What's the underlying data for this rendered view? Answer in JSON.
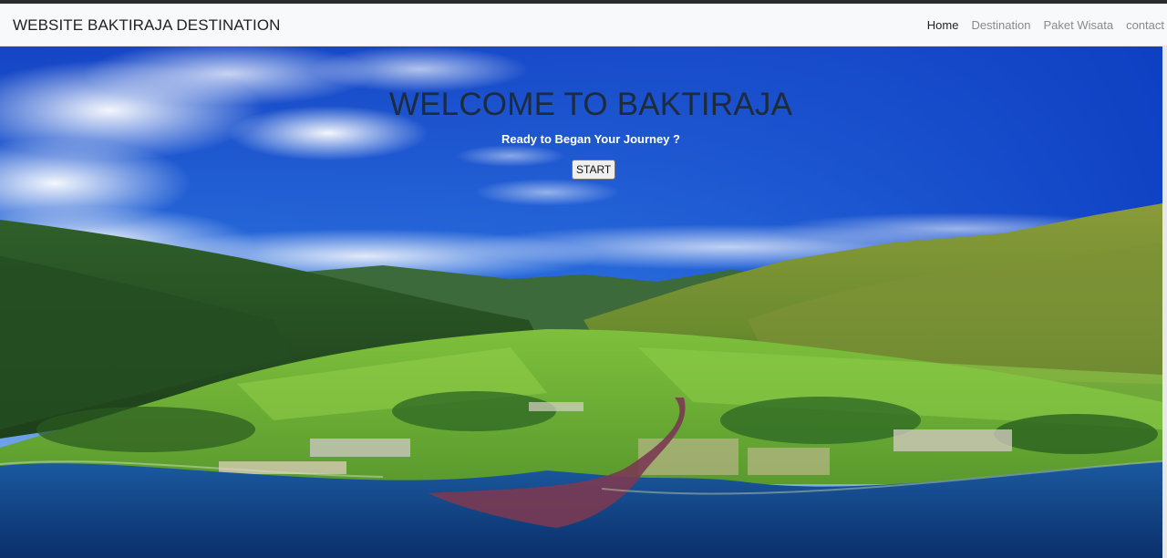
{
  "navbar": {
    "brand": "WEBSITE BAKTIRAJA DESTINATION",
    "links": [
      {
        "label": "Home",
        "active": true
      },
      {
        "label": "Destination",
        "active": false
      },
      {
        "label": "Paket Wisata",
        "active": false
      },
      {
        "label": "contact",
        "active": false
      }
    ]
  },
  "hero": {
    "title": "WELCOME TO BAKTIRAJA",
    "subtitle": "Ready to Began Your Journey ?",
    "start_label": "START",
    "background": "aerial-valley-lake-photo"
  },
  "colors": {
    "sky_top": "#1146c8",
    "sky_light": "#4f8fe0",
    "hill_green": "#3f7a2a",
    "field_green": "#7cbf3a",
    "lake_blue": "#0f3f82",
    "river_red": "#7a3a52"
  }
}
